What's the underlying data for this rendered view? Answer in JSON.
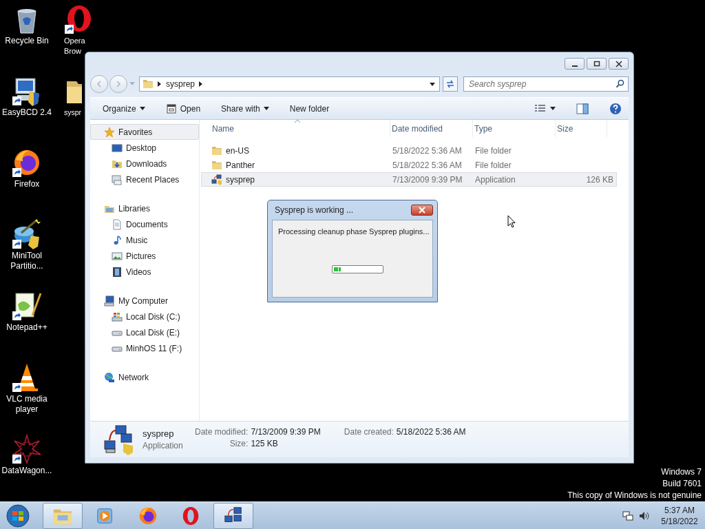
{
  "desktop": {
    "icons": [
      {
        "label": "Recycle Bin",
        "kind": "recycle",
        "shortcut": false
      },
      {
        "label": "EasyBCD 2.4",
        "kind": "easybcd",
        "shortcut": true
      },
      {
        "label": "Firefox",
        "kind": "firefox",
        "shortcut": true
      },
      {
        "label": "MiniTool Partitio...",
        "kind": "minitool",
        "shortcut": true
      },
      {
        "label": "Notepad++",
        "kind": "notepad",
        "shortcut": true
      },
      {
        "label": "VLC media player",
        "kind": "vlc",
        "shortcut": true
      },
      {
        "label": "DataWagon...",
        "kind": "datawagon",
        "shortcut": true
      },
      {
        "label": "Opera Brow",
        "kind": "opera",
        "shortcut": true
      },
      {
        "label": "syspr",
        "kind": "folder",
        "shortcut": false
      }
    ],
    "notice": [
      "Windows 7",
      "Build 7601",
      "This copy of Windows is not genuine"
    ]
  },
  "explorer": {
    "address": [
      "sysprep"
    ],
    "search": {
      "placeholder": "Search sysprep"
    },
    "toolbar": [
      {
        "label": "Organize",
        "kind": "menu"
      },
      {
        "label": "Open",
        "kind": "open"
      },
      {
        "label": "Share with",
        "kind": "menu"
      },
      {
        "label": "New folder",
        "kind": "plain"
      }
    ],
    "nav": [
      {
        "label": "Favorites",
        "kind": "star",
        "selected": true,
        "children": [
          {
            "label": "Desktop",
            "kind": "desktop",
            "selected": false
          },
          {
            "label": "Downloads",
            "kind": "downloads",
            "selected": false
          },
          {
            "label": "Recent Places",
            "kind": "recent",
            "selected": false
          }
        ]
      },
      {
        "label": "Libraries",
        "kind": "library",
        "selected": false,
        "children": [
          {
            "label": "Documents",
            "kind": "document",
            "selected": false
          },
          {
            "label": "Music",
            "kind": "music",
            "selected": false
          },
          {
            "label": "Pictures",
            "kind": "pictures",
            "selected": false
          },
          {
            "label": "Videos",
            "kind": "videos",
            "selected": false
          }
        ]
      },
      {
        "label": "My Computer",
        "kind": "computer",
        "selected": false,
        "children": [
          {
            "label": "Local Disk (C:)",
            "kind": "systemdisk",
            "selected": false
          },
          {
            "label": "Local Disk (E:)",
            "kind": "disk",
            "selected": false
          },
          {
            "label": "MinhOS 11 (F:)",
            "kind": "disk",
            "selected": false
          }
        ]
      },
      {
        "label": "Network",
        "kind": "network",
        "selected": false
      }
    ],
    "columns": [
      "Name",
      "Date modified",
      "Type",
      "Size"
    ],
    "rows": [
      {
        "name": "en-US",
        "date": "5/18/2022 5:36 AM",
        "type": "File folder",
        "kind": "folder",
        "selected": false
      },
      {
        "name": "Panther",
        "date": "5/18/2022 5:36 AM",
        "type": "File folder",
        "kind": "folder",
        "selected": false
      },
      {
        "name": "sysprep",
        "date": "7/13/2009 9:39 PM",
        "type": "Application",
        "size": "126 KB",
        "kind": "application",
        "selected": true
      }
    ],
    "details": {
      "name": "sysprep",
      "type": "Application",
      "fields": [
        {
          "label": "Date modified:",
          "value": "7/13/2009 9:39 PM"
        },
        {
          "label": "Size:",
          "value": "125 KB"
        },
        {
          "label": "Date created:",
          "value": "5/18/2022 5:36 AM"
        }
      ]
    }
  },
  "dialog": {
    "title": "Sysprep is working ...",
    "message": "Processing cleanup phase Sysprep plugins...",
    "progress": {
      "level": 0.15
    }
  },
  "taskbar": {
    "items": [
      {
        "kind": "explorer",
        "selected": true
      },
      {
        "kind": "mediaplayer",
        "selected": false
      },
      {
        "kind": "firefox",
        "selected": false
      },
      {
        "kind": "opera",
        "selected": false
      },
      {
        "kind": "sysprep",
        "selected": true
      }
    ],
    "time": "5:37 AM",
    "date": "5/18/2022"
  }
}
